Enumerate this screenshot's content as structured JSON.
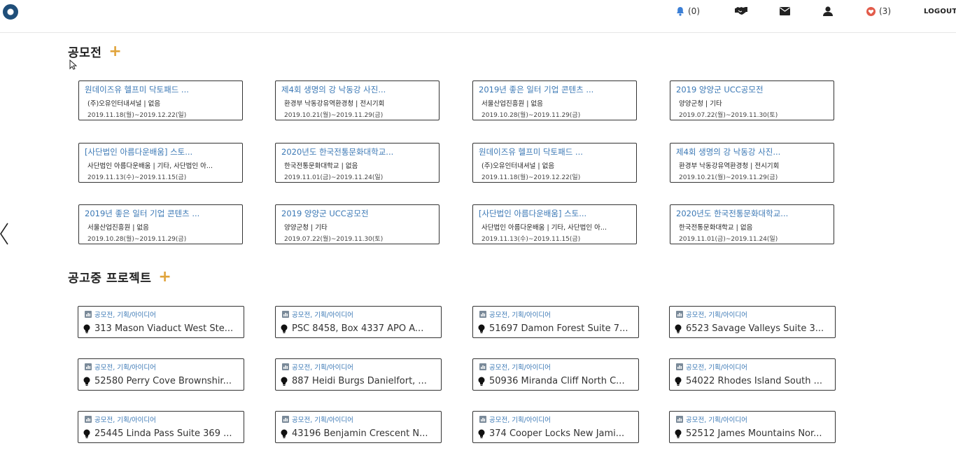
{
  "header": {
    "notifications": "(0)",
    "favorites": "(3)",
    "logout": "LOGOUT"
  },
  "contests": {
    "title": "공모전",
    "plus": "+",
    "cards": [
      {
        "title": "원데이즈유 헬프미 닥토패드 ...",
        "org": "(주)오유인터내셔널 | 없음",
        "period": "2019.11.18(월)~2019.12.22(일)"
      },
      {
        "title": "제4회 생명의 강 낙동강 사진...",
        "org": "환경부 낙동강유역환경청 | 전시기회",
        "period": "2019.10.21(월)~2019.11.29(금)"
      },
      {
        "title": "2019년 좋은 일터 기업 콘텐츠 ...",
        "org": "서울산업진흥원 | 없음",
        "period": "2019.10.28(월)~2019.11.29(금)"
      },
      {
        "title": "2019 양양군 UCC공모전",
        "org": "양양군청 | 기타",
        "period": "2019.07.22(월)~2019.11.30(토)"
      },
      {
        "title": "[사단법인 아름다운배움] 스토...",
        "org": "사단법인 아름다운배움 | 기타, 사단법인 아...",
        "period": "2019.11.13(수)~2019.11.15(금)"
      },
      {
        "title": "2020년도 한국전통문화대학교...",
        "org": "한국전통문화대학교 | 없음",
        "period": "2019.11.01(금)~2019.11.24(일)"
      },
      {
        "title": "원데이즈유 헬프미 닥토패드 ...",
        "org": "(주)오유인터내셔널 | 없음",
        "period": "2019.11.18(월)~2019.12.22(일)"
      },
      {
        "title": "제4회 생명의 강 낙동강 사진...",
        "org": "환경부 낙동강유역환경청 | 전시기회",
        "period": "2019.10.21(월)~2019.11.29(금)"
      },
      {
        "title": "2019년 좋은 일터 기업 콘텐츠 ...",
        "org": "서울산업진흥원 | 없음",
        "period": "2019.10.28(월)~2019.11.29(금)"
      },
      {
        "title": "2019 양양군 UCC공모전",
        "org": "양양군청 | 기타",
        "period": "2019.07.22(월)~2019.11.30(토)"
      },
      {
        "title": "[사단법인 아름다운배움] 스토...",
        "org": "사단법인 아름다운배움 | 기타, 사단법인 아...",
        "period": "2019.11.13(수)~2019.11.15(금)"
      },
      {
        "title": "2020년도 한국전통문화대학교...",
        "org": "한국전통문화대학교 | 없음",
        "period": "2019.11.01(금)~2019.11.24(일)"
      }
    ]
  },
  "projects": {
    "title": "공고중 프로젝트",
    "plus": "+",
    "cards": [
      {
        "category": "공모전, 기획/아이디어",
        "address": "313 Mason Viaduct West Ste..."
      },
      {
        "category": "공모전, 기획/아이디어",
        "address": "PSC 8458, Box 4337 APO A..."
      },
      {
        "category": "공모전, 기획/아이디어",
        "address": "51697 Damon Forest Suite 7..."
      },
      {
        "category": "공모전, 기획/아이디어",
        "address": "6523 Savage Valleys Suite 3..."
      },
      {
        "category": "공모전, 기획/아이디어",
        "address": "52580 Perry Cove Brownshir..."
      },
      {
        "category": "공모전, 기획/아이디어",
        "address": "887 Heidi Burgs Danielfort, ..."
      },
      {
        "category": "공모전, 기획/아이디어",
        "address": "50936 Miranda Cliff North C..."
      },
      {
        "category": "공모전, 기획/아이디어",
        "address": "54022 Rhodes Island South ..."
      },
      {
        "category": "공모전, 기획/아이디어",
        "address": "25445 Linda Pass Suite 369 ..."
      },
      {
        "category": "공모전, 기획/아이디어",
        "address": "43196 Benjamin Crescent N..."
      },
      {
        "category": "공모전, 기획/아이디어",
        "address": "374 Cooper Locks New Jami..."
      },
      {
        "category": "공모전, 기획/아이디어",
        "address": "52512 James Mountains Nor..."
      }
    ]
  },
  "colors": {
    "accent": "#e0a33a",
    "link": "#3b78b5",
    "bell": "#3b7fd6",
    "heart": "#e25b4a"
  },
  "icons": [
    "logo-icon",
    "bell-icon",
    "handshake-icon",
    "envelope-icon",
    "user-icon",
    "heart-icon",
    "chart-icon",
    "lightbulb-icon",
    "chevron-left-icon",
    "cursor-icon"
  ]
}
